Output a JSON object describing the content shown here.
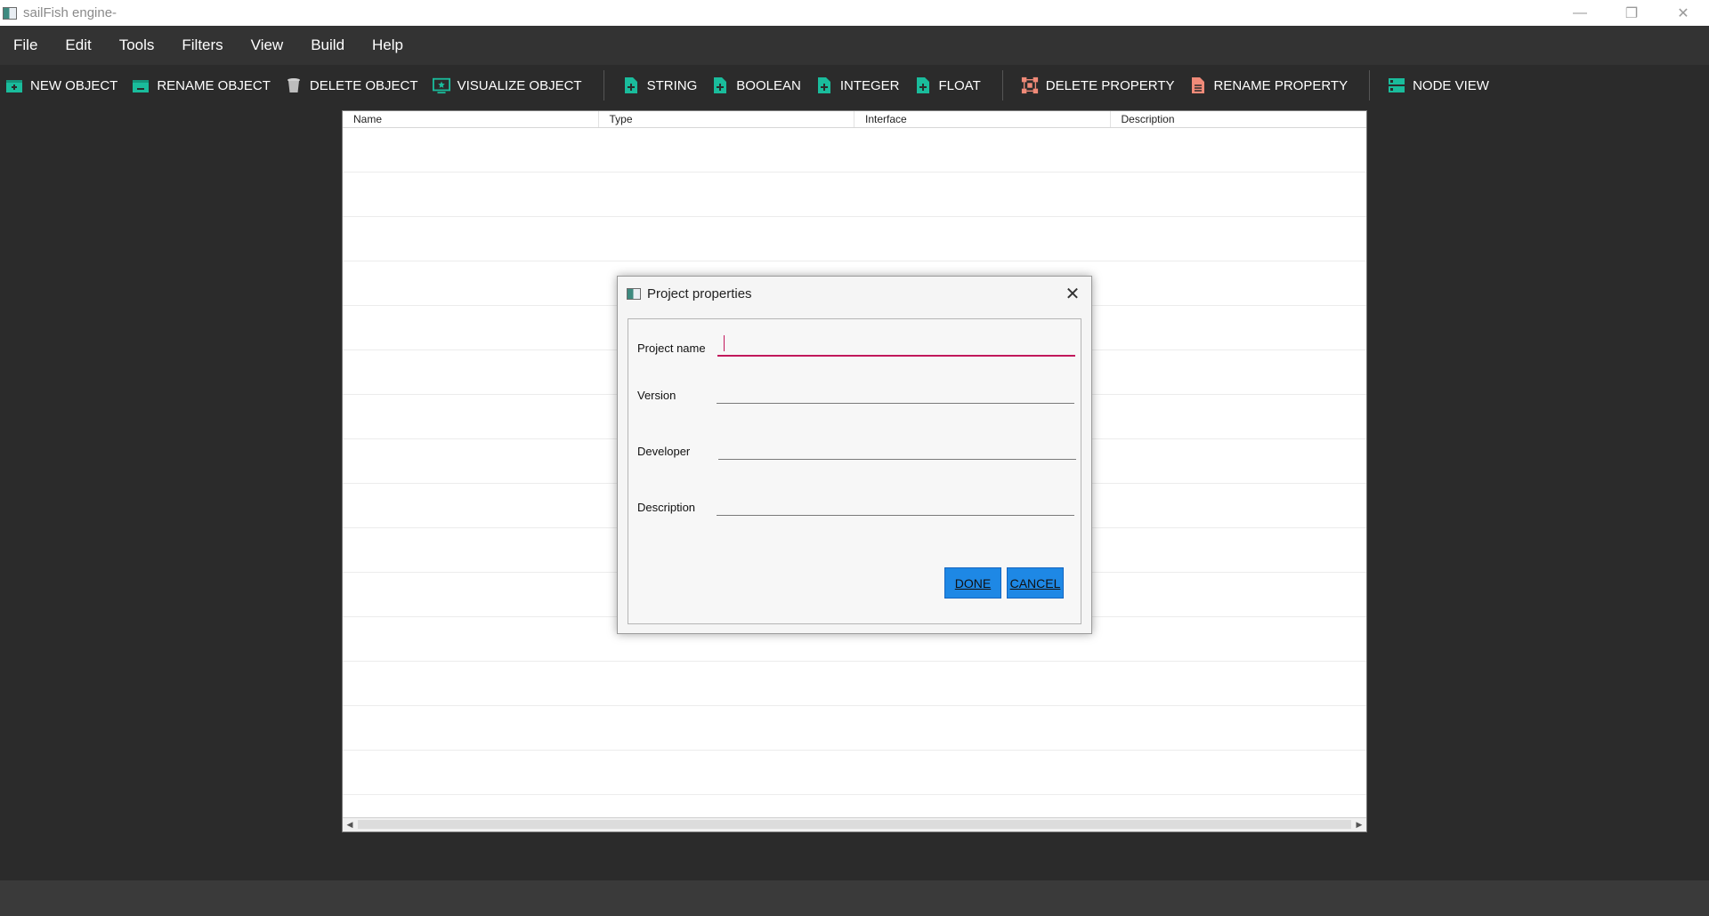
{
  "window": {
    "title": "sailFish engine-",
    "controls": {
      "minimize": "—",
      "restore": "❐",
      "close": "✕"
    }
  },
  "menu": [
    "File",
    "Edit",
    "Tools",
    "Filters",
    "View",
    "Build",
    "Help"
  ],
  "toolbar": {
    "object_group": [
      {
        "label": "NEW OBJECT",
        "icon": "new-object-icon"
      },
      {
        "label": "RENAME OBJECT",
        "icon": "rename-object-icon"
      },
      {
        "label": "DELETE OBJECT",
        "icon": "trash-icon"
      },
      {
        "label": "VISUALIZE OBJECT",
        "icon": "visualize-icon"
      }
    ],
    "type_group": [
      {
        "label": "STRING",
        "icon": "add-file-icon"
      },
      {
        "label": "BOOLEAN",
        "icon": "add-file-icon"
      },
      {
        "label": "INTEGER",
        "icon": "add-file-icon"
      },
      {
        "label": "FLOAT",
        "icon": "add-file-icon"
      }
    ],
    "property_group": [
      {
        "label": "DELETE PROPERTY",
        "icon": "delete-property-icon"
      },
      {
        "label": "RENAME PROPERTY",
        "icon": "rename-property-icon"
      }
    ],
    "view_group": [
      {
        "label": "NODE VIEW",
        "icon": "node-view-icon"
      }
    ]
  },
  "table": {
    "columns": [
      "Name",
      "Type",
      "Interface",
      "Description"
    ],
    "rows": []
  },
  "dialog": {
    "title": "Project properties",
    "close_symbol": "✕",
    "fields": {
      "project_name": {
        "label": "Project name",
        "value": ""
      },
      "version": {
        "label": "Version",
        "value": ""
      },
      "developer": {
        "label": "Developer",
        "value": ""
      },
      "description": {
        "label": "Description",
        "value": ""
      }
    },
    "done_label": "DONE",
    "cancel_label": "CANCEL"
  },
  "colors": {
    "accent_teal": "#1abc9c",
    "accent_salmon": "#f08a78",
    "button_blue": "#1e88e5",
    "focus_pink": "#c2185b"
  }
}
